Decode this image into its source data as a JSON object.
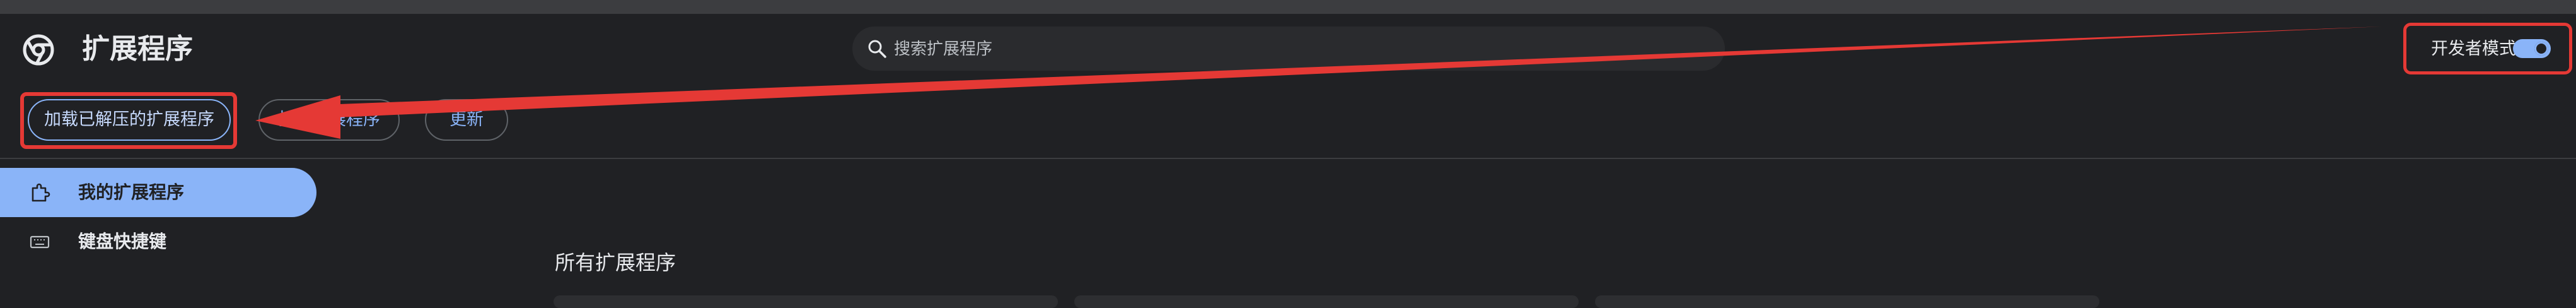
{
  "header": {
    "title": "扩展程序"
  },
  "search": {
    "placeholder": "搜索扩展程序"
  },
  "developer_mode": {
    "label": "开发者模式",
    "enabled": true
  },
  "toolbar": {
    "load_unpacked_label": "加载已解压的扩展程序",
    "pack_label": "打包扩展程序",
    "update_label": "更新"
  },
  "sidebar": {
    "items": [
      {
        "label": "我的扩展程序",
        "icon": "puzzle-icon",
        "active": true
      },
      {
        "label": "键盘快捷键",
        "icon": "keyboard-icon",
        "active": false
      }
    ]
  },
  "main": {
    "section_title": "所有扩展程序"
  },
  "colors": {
    "background": "#202124",
    "accent": "#8ab4f8",
    "annotation": "#e53935"
  }
}
